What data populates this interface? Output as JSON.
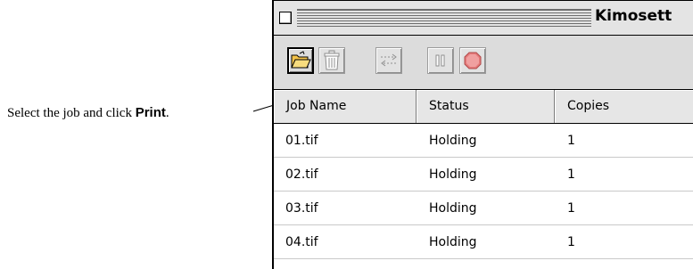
{
  "callout": {
    "text_before": "Select the job and click ",
    "text_bold": "Print",
    "text_after": "."
  },
  "window": {
    "title": "Kimosett"
  },
  "toolbar": {
    "buttons": [
      {
        "icon": "folder-open-icon",
        "state": "active"
      },
      {
        "icon": "trash-icon",
        "state": "disabled"
      },
      {
        "icon": "print-transfer-icon",
        "state": "disabled"
      },
      {
        "icon": "pause-icon",
        "state": "disabled"
      },
      {
        "icon": "stop-icon",
        "state": "disabled"
      }
    ]
  },
  "jobs_table": {
    "columns": [
      "Job Name",
      "Status",
      "Copies"
    ],
    "rows": [
      {
        "name": "01.tif",
        "status": "Holding",
        "copies": "1"
      },
      {
        "name": "02.tif",
        "status": "Holding",
        "copies": "1"
      },
      {
        "name": "03.tif",
        "status": "Holding",
        "copies": "1"
      },
      {
        "name": "04.tif",
        "status": "Holding",
        "copies": "1"
      }
    ]
  }
}
